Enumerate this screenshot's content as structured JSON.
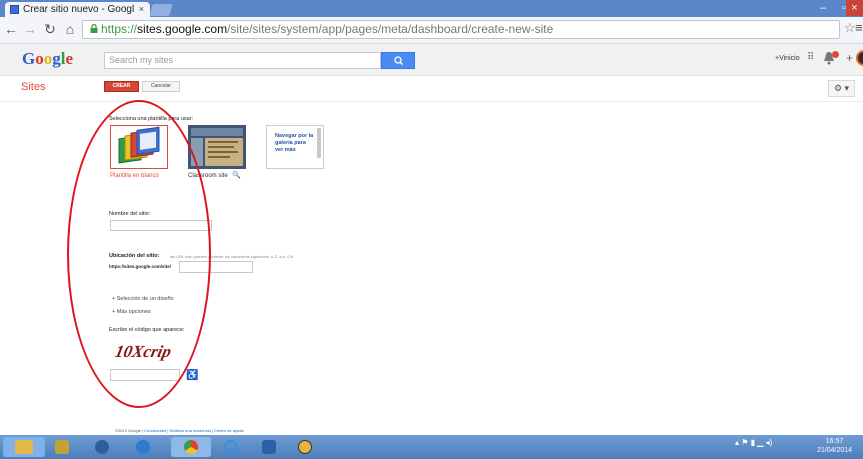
{
  "browser": {
    "tab_title": "Crear sitio nuevo - Googl",
    "tab_close": "×",
    "url_prefix": "https://",
    "url_host": "sites.google.com",
    "url_path": "/site/sites/system/app/pages/meta/dashboard/create-new-site",
    "minimize": "–",
    "maximize": "▫",
    "close": "×"
  },
  "google_bar": {
    "logo_letters": [
      "G",
      "o",
      "o",
      "g",
      "l",
      "e"
    ],
    "search_placeholder": "Search my sites",
    "user_name": "+Vinicio"
  },
  "header": {
    "app_name": "Sites",
    "create_label": "CREAR",
    "cancel_label": "Cancelar",
    "settings_label": "⚙ ▾"
  },
  "form": {
    "template_label": "Selecciona una plantilla para usar:",
    "templates": [
      {
        "label": "Plantilla en blanco",
        "selected": true
      },
      {
        "label": "Classroom site",
        "selected": false
      },
      {
        "label": "Navegar por la galería para ver más",
        "selected": false
      }
    ],
    "site_name_label": "Nombre del sitio:",
    "location_label": "Ubicación del sitio:",
    "location_hint": "las URL solo pueden contener los caracteres siguientes: A-Z, a-z, 0-9",
    "location_prefix": "https://sites.google.com/site/",
    "theme_link": "+ Selección de un diseño",
    "more_link": "+ Más opciones",
    "captcha_label": "Escribe el código que aparece:",
    "captcha_text": "10Xcrip"
  },
  "footer": {
    "copyright": "©2014 Google | ",
    "links": "Condiciones | Notificar una incidencia | Centro de ayuda"
  },
  "taskbar": {
    "time": "16:57",
    "date": "21/04/2014"
  },
  "colors": {
    "accent_red": "#dd4b39",
    "google_blue": "#4a8af4",
    "annotation": "#e0141e"
  }
}
